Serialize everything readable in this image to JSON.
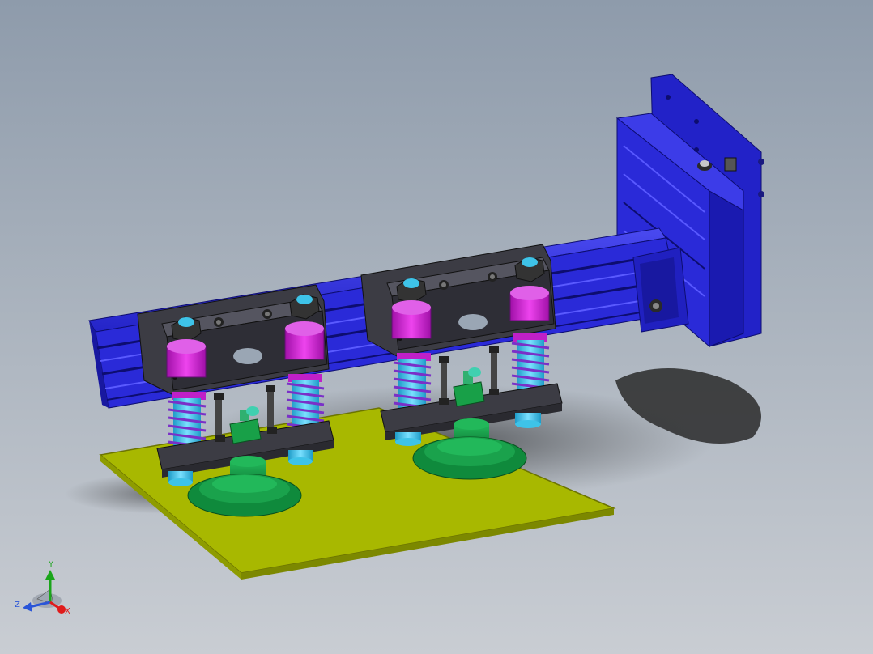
{
  "viewport": {
    "background_top": "#8e9bab",
    "background_bottom": "#c9cdd3"
  },
  "model": {
    "rail_color": "#2a2ad8",
    "plate_color": "#a8b800",
    "bracket_color": "#3c3c44",
    "spring_color": "#7a30c8",
    "bushing_color": "#cc22cc",
    "rod_color": "#3ec3e8",
    "suction_cup_color": "#18a048",
    "fitting_color": "#30b070"
  },
  "triad": {
    "x_label": "X",
    "y_label": "Y",
    "z_label": "Z",
    "x_color": "#e01b1b",
    "y_color": "#1aa51a",
    "z_color": "#2a55d8"
  }
}
